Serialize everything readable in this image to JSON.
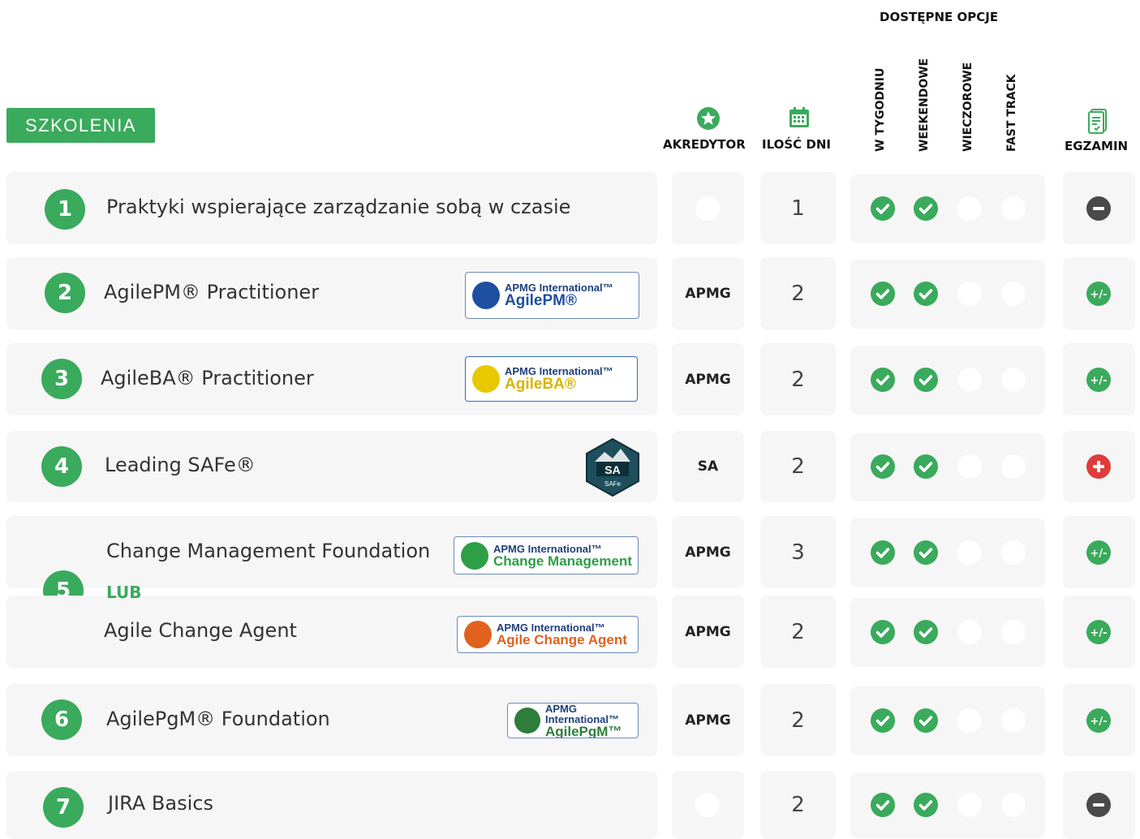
{
  "header": {
    "section_label": "SZKOLENIA",
    "options_group": "DOSTĘPNE OPCJE",
    "col_accreditor": "AKREDYTOR",
    "col_days": "ILOŚĆ DNI",
    "col_weekday": "W TYGODNIU",
    "col_weekend": "WEEKENDOWE",
    "col_evening": "WIECZOROWE",
    "col_fasttrack": "FAST TRACK",
    "col_exam": "EGZAMIN"
  },
  "separator_label": "LUB",
  "courses": [
    {
      "num": "1",
      "title": "Praktyki wspierające zarządzanie sobą w czasie",
      "accreditor": "",
      "days": "1",
      "options": [
        true,
        true,
        false,
        false
      ],
      "exam": "none",
      "logo": null
    },
    {
      "num": "2",
      "title": "AgilePM® Practitioner",
      "accreditor": "APMG",
      "days": "2",
      "options": [
        true,
        true,
        false,
        false
      ],
      "exam": "optional",
      "logo": {
        "line1": "APMG International™",
        "line2": "AgilePM®",
        "color": "#1f4fa0"
      }
    },
    {
      "num": "3",
      "title": "AgileBA® Practitioner",
      "accreditor": "APMG",
      "days": "2",
      "options": [
        true,
        true,
        false,
        false
      ],
      "exam": "optional",
      "logo": {
        "line1": "APMG International™",
        "line2": "AgileBA®",
        "color": "#e8c800"
      }
    },
    {
      "num": "4",
      "title": "Leading SAFe®",
      "accreditor": "SA",
      "days": "2",
      "options": [
        true,
        true,
        false,
        false
      ],
      "exam": "included",
      "logo": {
        "line1": "SA",
        "line2": "SAFe",
        "color": "#1f4f5c"
      }
    },
    {
      "num": "5",
      "title": "Change Management Foundation",
      "accreditor": "APMG",
      "days": "3",
      "options": [
        true,
        true,
        false,
        false
      ],
      "exam": "optional",
      "logo": {
        "line1": "APMG International™",
        "line2": "Change Management",
        "color": "#2e9e47"
      }
    },
    {
      "num": "",
      "title": "Agile Change Agent",
      "accreditor": "APMG",
      "days": "2",
      "options": [
        true,
        true,
        false,
        false
      ],
      "exam": "optional",
      "logo": {
        "line1": "APMG International™",
        "line2": "Agile Change Agent",
        "color": "#e0621e"
      }
    },
    {
      "num": "6",
      "title": "AgilePgM® Foundation",
      "accreditor": "APMG",
      "days": "2",
      "options": [
        true,
        true,
        false,
        false
      ],
      "exam": "optional",
      "logo": {
        "line1": "APMG International™",
        "line2": "AgilePgM™",
        "color": "#2e7d3a"
      }
    },
    {
      "num": "7",
      "title": "JIRA Basics",
      "accreditor": "",
      "days": "2",
      "options": [
        true,
        true,
        false,
        false
      ],
      "exam": "none",
      "logo": null
    }
  ],
  "icons": {
    "accreditor": "star-badge-icon",
    "days": "calendar-icon",
    "exam": "exam-sheet-icon"
  },
  "colors": {
    "green": "#3aaa5c",
    "red": "#e03c3c",
    "gray": "#4a4a4a"
  }
}
